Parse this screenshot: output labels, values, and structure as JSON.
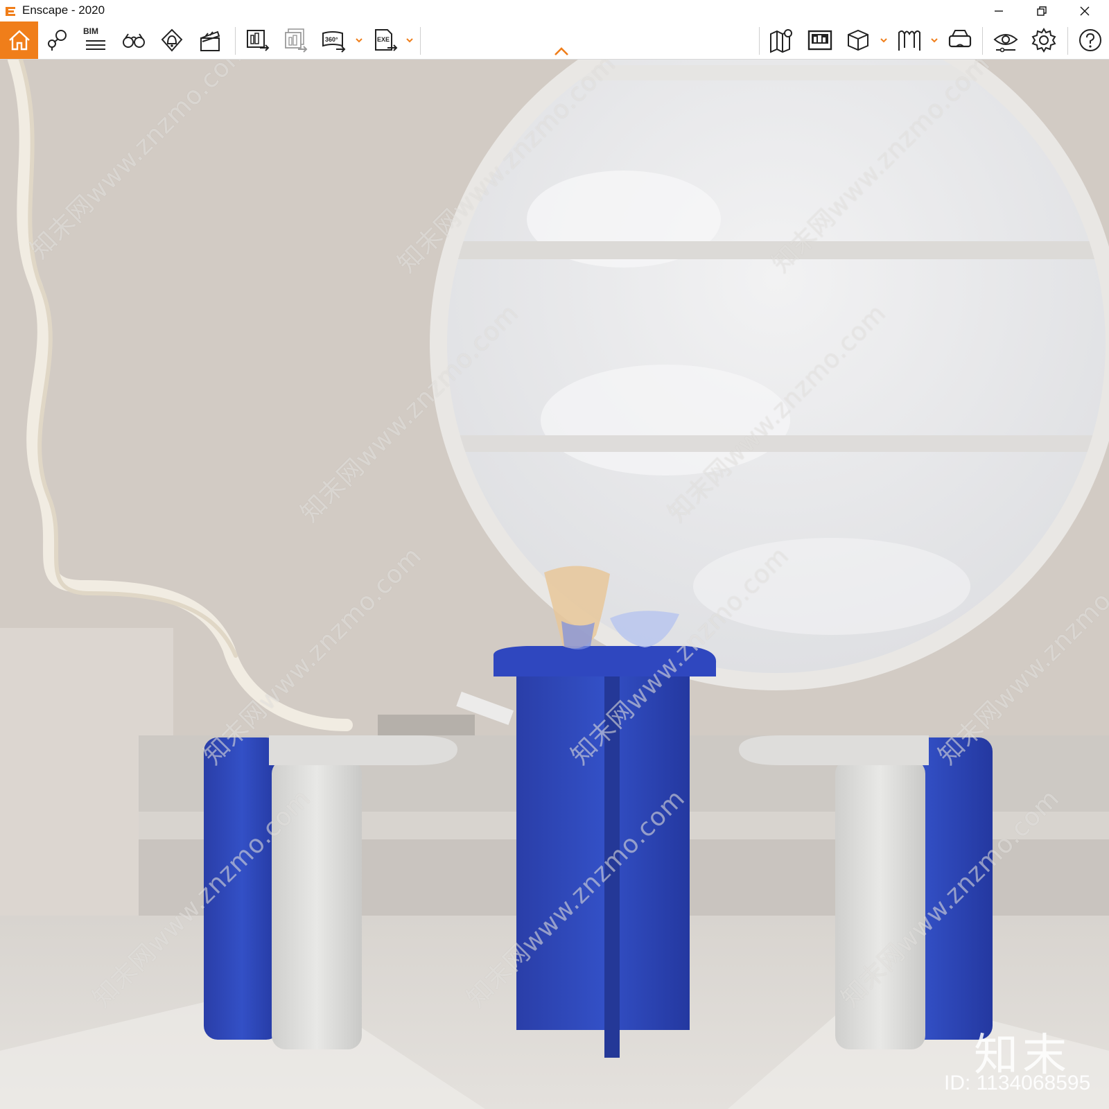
{
  "window": {
    "title": "Enscape - 2020",
    "controls": {
      "minimize": "minimize",
      "restore": "restore",
      "close": "close"
    }
  },
  "toolbar": {
    "accent_color": "#f07e1a",
    "bim_label": "BIM",
    "left_tools": [
      {
        "name": "home",
        "icon": "home-icon"
      },
      {
        "name": "views",
        "icon": "map-pin-icon"
      },
      {
        "name": "bim",
        "icon": "bim-icon"
      },
      {
        "name": "walk",
        "icon": "binoculars-icon"
      },
      {
        "name": "sound",
        "icon": "bell-icon"
      },
      {
        "name": "video",
        "icon": "clapperboard-icon"
      },
      {
        "name": "render-image",
        "icon": "render-image-icon"
      },
      {
        "name": "batch-render",
        "icon": "batch-render-icon"
      },
      {
        "name": "panorama",
        "icon": "panorama-360-icon",
        "text": "360°"
      },
      {
        "name": "export-exe",
        "icon": "export-exe-icon",
        "text": "EXE"
      }
    ],
    "right_tools": [
      {
        "name": "map",
        "icon": "map-icon"
      },
      {
        "name": "capture",
        "icon": "capture-icon"
      },
      {
        "name": "asset",
        "icon": "cube-icon"
      },
      {
        "name": "library",
        "icon": "library-icon"
      },
      {
        "name": "vr",
        "icon": "vr-headset-icon"
      },
      {
        "name": "visual-settings",
        "icon": "eye-settings-icon"
      },
      {
        "name": "settings",
        "icon": "gear-icon"
      },
      {
        "name": "help",
        "icon": "help-icon"
      }
    ]
  },
  "viewport": {
    "watermark_text": "知末网www.znzmo.com",
    "brand": "知末",
    "id_label": "ID: 1134068595",
    "colors": {
      "wall": "#d3ccc5",
      "blue": "#2f45b8",
      "white_table": "#dcdbd8",
      "floor": "#dedad5"
    }
  }
}
